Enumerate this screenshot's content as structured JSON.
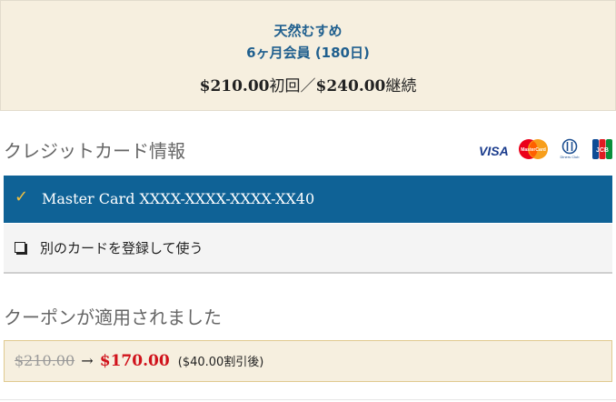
{
  "plan": {
    "name": "天然むすめ",
    "duration": "6ヶ月会員 (180日)",
    "price_initial": "$210.00",
    "initial_suffix": "初回／",
    "price_renewal": "$240.00",
    "renewal_suffix": "継続"
  },
  "credit_card": {
    "title": "クレジットカード情報",
    "logos": [
      "visa-logo",
      "mastercard-logo",
      "diners-club-logo",
      "jcb-logo"
    ],
    "logo_text": {
      "visa": "VISA",
      "mastercard": "MasterCard",
      "diners": "Diners Club",
      "jcb": "JCB"
    },
    "selected_card": "Master Card XXXX-XXXX-XXXX-XX40",
    "check_mark": "✓",
    "other_card_label": "別のカードを登録して使う"
  },
  "coupon": {
    "title": "クーポンが適用されました",
    "old_price": "$210.00",
    "arrow": "→",
    "new_price": "$170.00",
    "discount_note": "($40.00割引後)"
  },
  "colors": {
    "plan_bg": "#f6efdf",
    "accent_blue": "#0f6296",
    "price_red": "#d0121b"
  }
}
